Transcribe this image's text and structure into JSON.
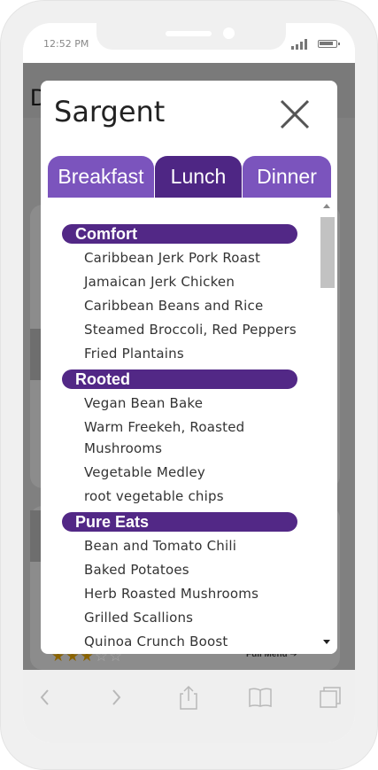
{
  "status_bar": {
    "time": "12:52 PM"
  },
  "background": {
    "header_letter": "D",
    "rating": {
      "filled": "★★★",
      "empty": "☆☆"
    },
    "full_menu_label": "Full Menu ➔"
  },
  "modal": {
    "title": "Sargent",
    "tabs": [
      {
        "label": "Breakfast",
        "active": false
      },
      {
        "label": "Lunch",
        "active": true
      },
      {
        "label": "Dinner",
        "active": false
      }
    ],
    "categories": [
      {
        "name": "Comfort",
        "items": [
          "Caribbean Jerk Pork Roast",
          "Jamaican Jerk Chicken",
          "Caribbean Beans and Rice",
          "Steamed Broccoli, Red Peppers",
          "Fried Plantains"
        ]
      },
      {
        "name": "Rooted",
        "items": [
          "Vegan Bean Bake",
          "Warm Freekeh, Roasted Mushrooms",
          "Vegetable Medley",
          "root vegetable chips"
        ]
      },
      {
        "name": "Pure Eats",
        "items": [
          "Bean and Tomato Chili",
          "Baked Potatoes",
          "Herb Roasted Mushrooms",
          "Grilled Scallions",
          "Quinoa Crunch Boost"
        ]
      }
    ]
  },
  "colors": {
    "tab_inactive": "#7b54bd",
    "tab_active": "#4e2684",
    "category_bg": "#522886",
    "overlay": "#808080"
  },
  "icons": [
    "signal-icon",
    "battery-icon",
    "close-icon",
    "back-icon",
    "forward-icon",
    "share-icon",
    "bookmarks-icon",
    "tabs-icon"
  ]
}
